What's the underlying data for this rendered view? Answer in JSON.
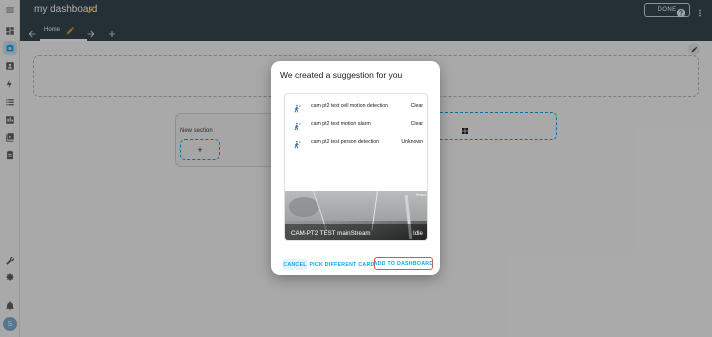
{
  "header": {
    "title": "my dashboard",
    "done_label": "DONE",
    "tab_home": "Home"
  },
  "sidebar": {
    "items": [
      "overview-icon",
      "camera-icon",
      "person-icon",
      "energy-icon",
      "list-icon",
      "history-icon",
      "media-icon",
      "todo-icon"
    ],
    "bottom": [
      "developer-tools-icon",
      "settings-icon",
      "notifications-icon"
    ],
    "avatar_initial": "S"
  },
  "background": {
    "section_title": "New section",
    "add_symbol": "+"
  },
  "dialog": {
    "title": "We created a suggestion for you",
    "entities": [
      {
        "name": "cam pt2 test cell motion detection",
        "state": "Clear",
        "icon": "motion-sensor-icon"
      },
      {
        "name": "cam pt2 test motion alarm",
        "state": "Clear",
        "icon": "motion-sensor-icon"
      },
      {
        "name": "cam pt2 test person detection",
        "state": "Unknown",
        "icon": "motion-sensor-icon"
      }
    ],
    "camera": {
      "name": "CAM-PT2 TEST mainStream",
      "state": "Idle",
      "timestamp_overlay": "Sensor"
    },
    "buttons": {
      "cancel": "CANCEL",
      "pick": "PICK DIFFERENT CARD",
      "add": "ADD TO DASHBOARD"
    }
  },
  "colors": {
    "header_bg": "#374850",
    "accent": "#03a9f4",
    "highlight_outline": "#e4572e",
    "pencil_orange": "#f4a11b"
  }
}
